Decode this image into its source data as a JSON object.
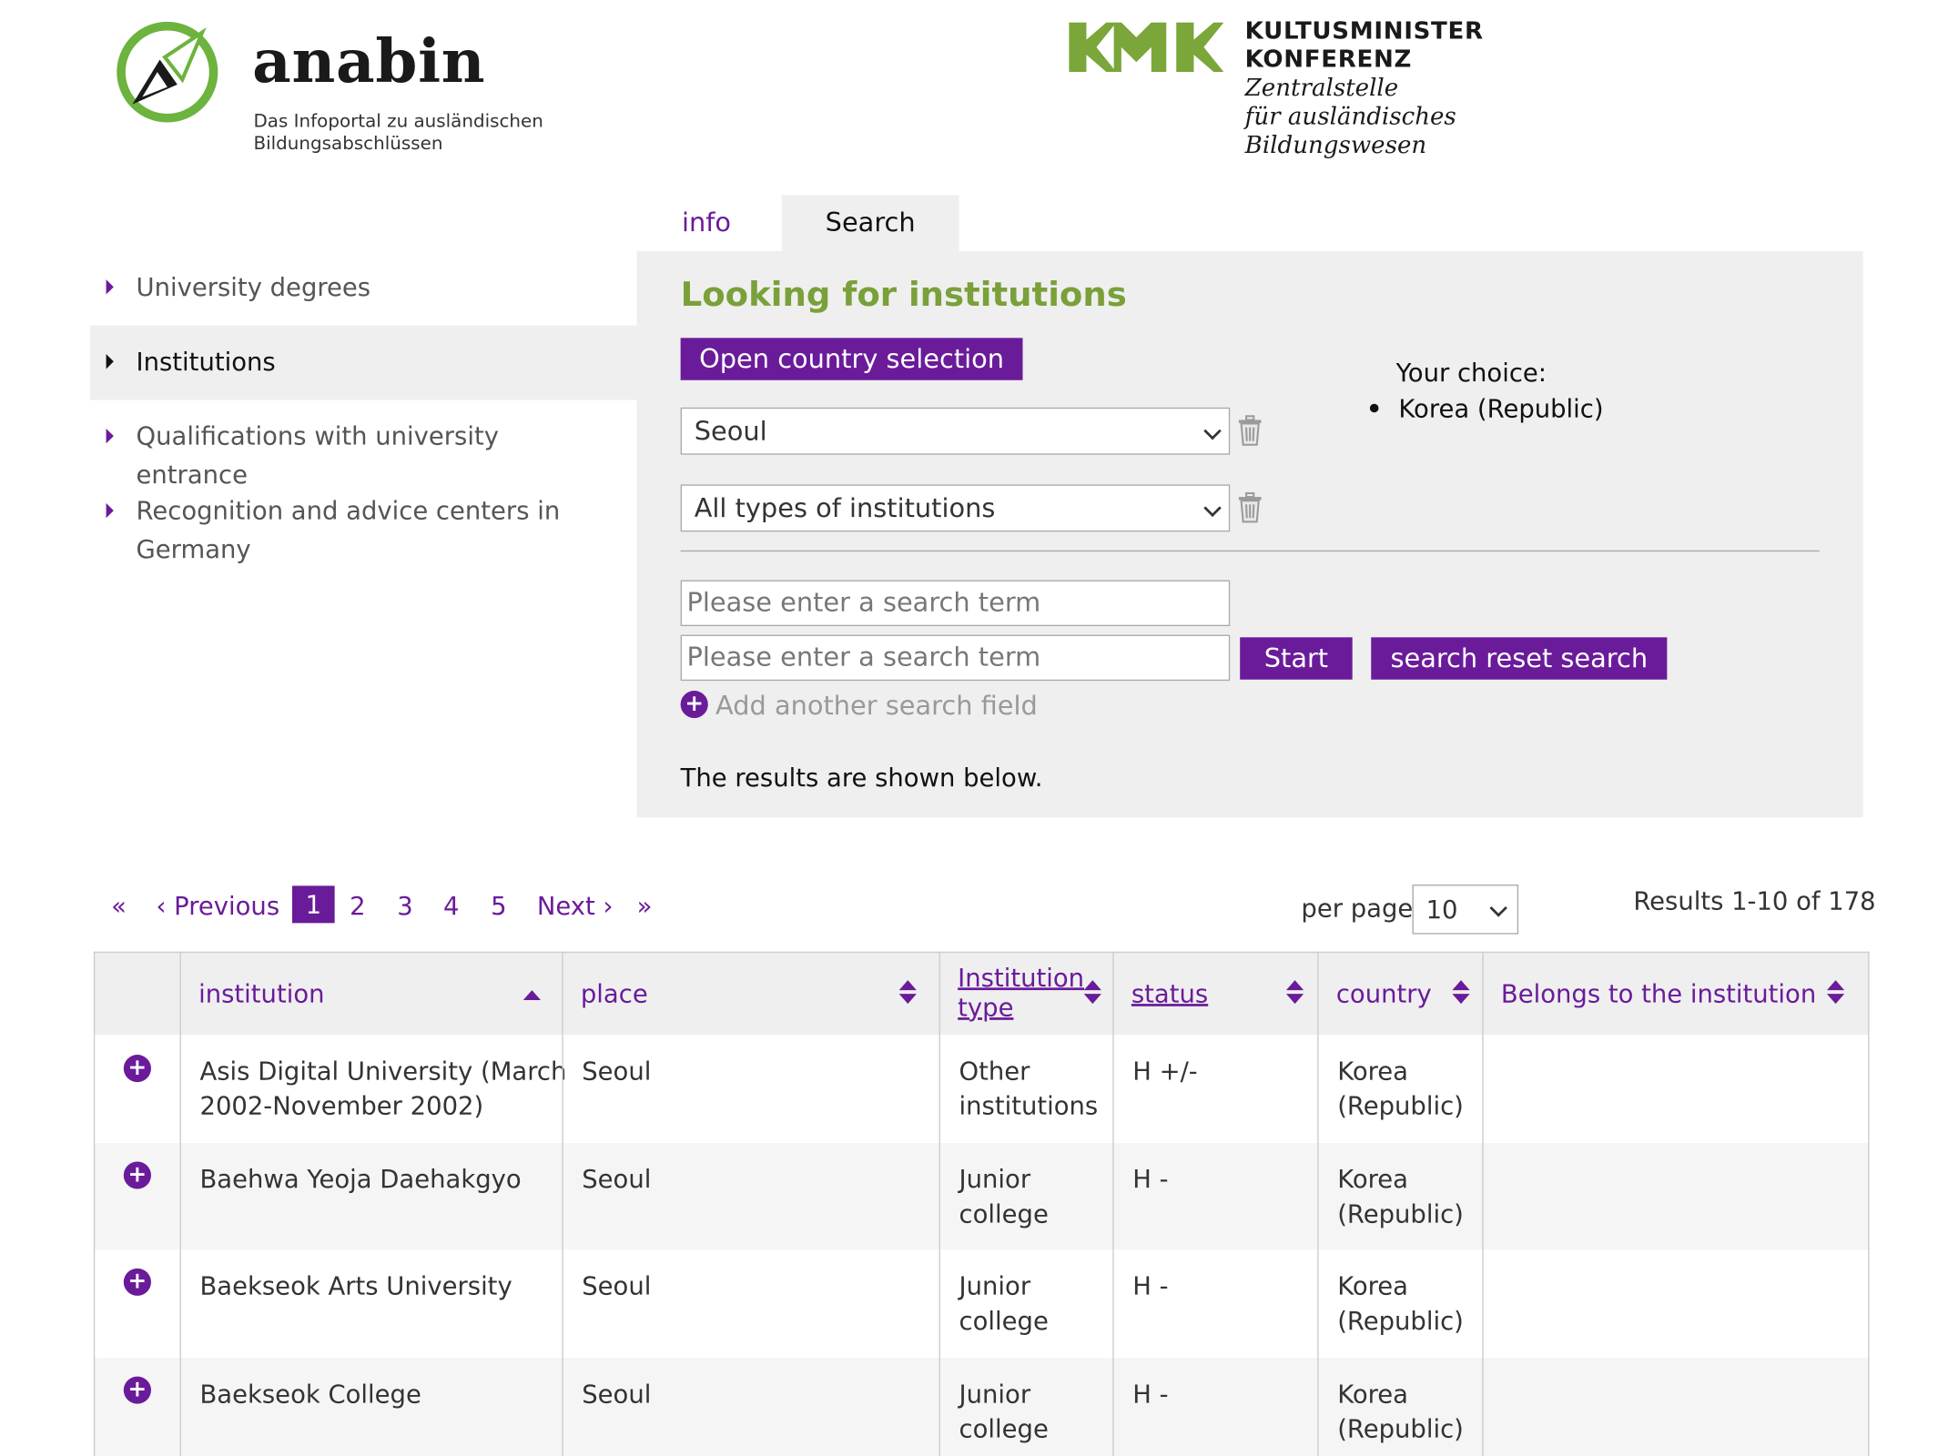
{
  "header": {
    "brand_name": "anabin",
    "brand_tagline": "Das Infoportal zu ausländischen Bildungsabschlüssen",
    "kmk_line1": "KULTUSMINISTER",
    "kmk_line2": "KONFERENZ",
    "kmk_line3": "Zentralstelle",
    "kmk_line4": "für ausländisches",
    "kmk_line5": "Bildungswesen",
    "colors": {
      "brand_green": "#6db33f",
      "kmk_green": "#7aa63a"
    }
  },
  "tabs": [
    {
      "label": "info",
      "active": false
    },
    {
      "label": "Search",
      "active": true
    }
  ],
  "sidebar": {
    "items": [
      {
        "label": "University degrees",
        "active": false
      },
      {
        "label": "Institutions",
        "active": true
      },
      {
        "label": "Qualifications with university entrance",
        "active": false
      },
      {
        "label": "Recognition and advice centers in Germany",
        "active": false
      }
    ]
  },
  "search": {
    "title": "Looking for institutions",
    "open_country_label": "Open country selection",
    "your_choice_label": "Your choice:",
    "choices": [
      "Korea (Republic)"
    ],
    "city_select": "Seoul",
    "type_select": "All types of institutions",
    "term_placeholder_1": "Please enter a search term",
    "term_placeholder_2": "Please enter a search term",
    "start_label": "Start",
    "reset_label": "search reset search",
    "add_field_label": "Add another search field",
    "results_note": "The results are shown below."
  },
  "pagination": {
    "first": "«",
    "previous": "‹ Previous",
    "pages": [
      "1",
      "2",
      "3",
      "4",
      "5"
    ],
    "current_page": "1",
    "next": "Next ›",
    "last": "»",
    "per_page_label": "per page",
    "per_page_value": "10",
    "results_count": "Results 1-10 of 178"
  },
  "table": {
    "headers": {
      "institution": "institution",
      "place": "place",
      "institution_type_1": "Institution",
      "institution_type_2": "type",
      "status": "status",
      "country": "country",
      "belongs": "Belongs to the institution"
    },
    "rows": [
      {
        "institution_1": "Asis Digital University (March",
        "institution_2": "2002-November 2002)",
        "place": "Seoul",
        "type_1": "Other",
        "type_2": "institutions",
        "status": "H +/-",
        "country_1": "Korea",
        "country_2": "(Republic)",
        "belongs": ""
      },
      {
        "institution_1": "Baehwa Yeoja Daehakgyo",
        "institution_2": "",
        "place": "Seoul",
        "type_1": "Junior",
        "type_2": "college",
        "status": "H -",
        "country_1": "Korea",
        "country_2": "(Republic)",
        "belongs": ""
      },
      {
        "institution_1": "Baekseok Arts University",
        "institution_2": "",
        "place": "Seoul",
        "type_1": "Junior",
        "type_2": "college",
        "status": "H -",
        "country_1": "Korea",
        "country_2": "(Republic)",
        "belongs": ""
      },
      {
        "institution_1": "Baekseok College",
        "institution_2": "",
        "place": "Seoul",
        "type_1": "Junior",
        "type_2": "college",
        "status": "H -",
        "country_1": "Korea",
        "country_2": "(Republic)",
        "belongs": ""
      }
    ]
  },
  "colors": {
    "accent": "#6a1b9a",
    "title_green": "#7aa03a",
    "panel_bg": "#efefef"
  }
}
